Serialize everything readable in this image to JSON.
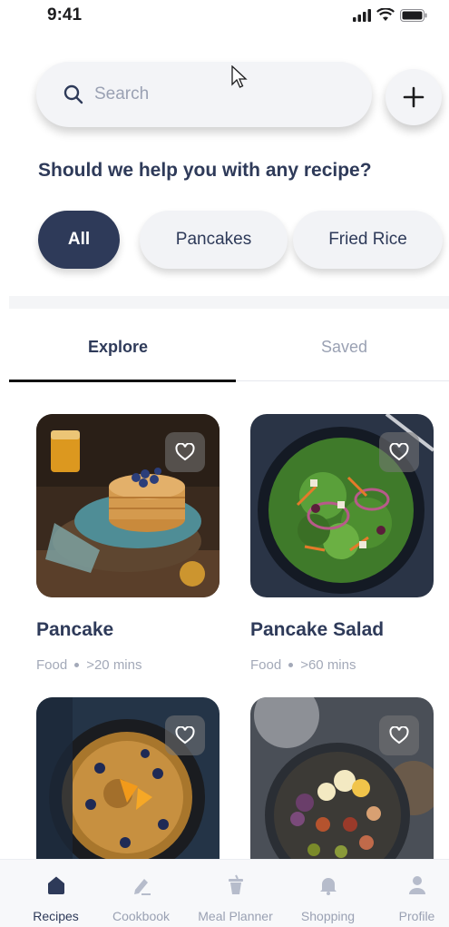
{
  "status": {
    "time": "9:41"
  },
  "search": {
    "placeholder": "Search"
  },
  "prompt": {
    "title": "Should we help you with any recipe?"
  },
  "chips": [
    {
      "label": "All",
      "active": true
    },
    {
      "label": "Pancakes",
      "active": false
    },
    {
      "label": "Fried Rice",
      "active": false
    }
  ],
  "tabs": [
    {
      "label": "Explore",
      "active": true
    },
    {
      "label": "Saved",
      "active": false
    }
  ],
  "recipes": [
    {
      "title": "Pancake",
      "category": "Food",
      "duration": ">20 mins"
    },
    {
      "title": "Pancake Salad",
      "category": "Food",
      "duration": ">60 mins"
    },
    {
      "title": "",
      "category": "",
      "duration": ""
    },
    {
      "title": "",
      "category": "",
      "duration": ""
    }
  ],
  "nav": [
    {
      "label": "Recipes",
      "icon": "home-icon",
      "active": true
    },
    {
      "label": "Cookbook",
      "icon": "pencil-icon",
      "active": false
    },
    {
      "label": "Meal Planner",
      "icon": "cup-icon",
      "active": false
    },
    {
      "label": "Shopping",
      "icon": "bell-icon",
      "active": false
    },
    {
      "label": "Profile",
      "icon": "user-icon",
      "active": false
    }
  ],
  "colors": {
    "primary": "#2e3a59",
    "muted": "#9aa1b3",
    "surface": "#f3f4f7"
  }
}
